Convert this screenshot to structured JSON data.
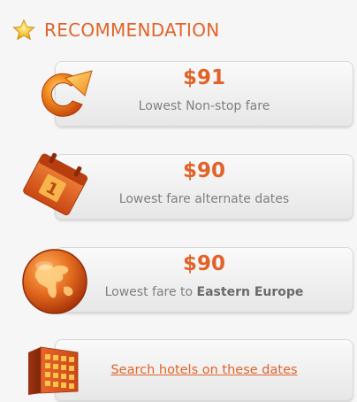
{
  "header": {
    "title": "RECOMMENDATION",
    "icon": "star-icon"
  },
  "cards": [
    {
      "icon": "refresh-arrow-icon",
      "price": "$91",
      "description": "Lowest Non-stop fare"
    },
    {
      "icon": "calendar-icon",
      "calendar_day": "1",
      "price": "$90",
      "description": "Lowest fare alternate dates"
    },
    {
      "icon": "globe-icon",
      "price": "$90",
      "description_prefix": "Lowest fare to",
      "description_bold": "Eastern Europe"
    },
    {
      "icon": "hotel-building-icon",
      "link": "Search hotels on these dates"
    }
  ],
  "colors": {
    "accent": "#e0642a",
    "muted_text": "#7f7f7f",
    "card_bg": "#ececec"
  }
}
